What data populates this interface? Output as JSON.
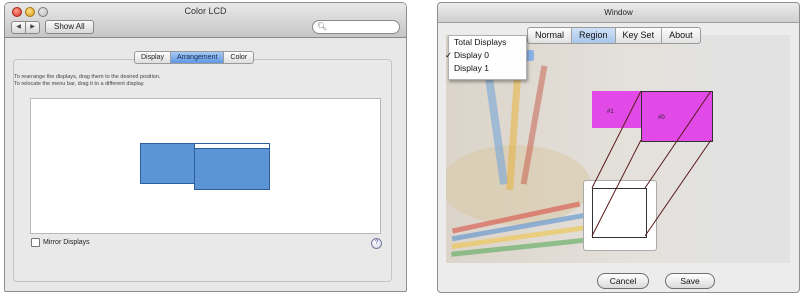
{
  "left_window": {
    "title": "Color LCD",
    "nav_back": "◀",
    "nav_forward": "▶",
    "show_all": "Show All",
    "search_icon": "search-icon",
    "search_placeholder": "",
    "tabs": [
      {
        "label": "Display",
        "active": false
      },
      {
        "label": "Arrangement",
        "active": true
      },
      {
        "label": "Color",
        "active": false
      }
    ],
    "instructions": [
      "To rearrange the displays, drag them to the desired position.",
      "To relocate the menu bar, drag it to a different display."
    ],
    "mirror_label": "Mirror Displays",
    "mirror_checked": false,
    "help_label": "?",
    "display_color": "#5b95d6"
  },
  "right_window": {
    "title": "Window",
    "tabs": [
      {
        "label": "Normal",
        "active": false
      },
      {
        "label": "Region",
        "active": true
      },
      {
        "label": "Key Set",
        "active": false
      },
      {
        "label": "About",
        "active": false
      }
    ],
    "dropdown_options": [
      {
        "label": "Total Displays",
        "checked": false
      },
      {
        "label": "Display 0",
        "checked": true
      },
      {
        "label": "Display 1",
        "checked": false
      }
    ],
    "check_mark": "✓",
    "region_labels": {
      "r1": "#1",
      "r0": "#0"
    },
    "region_color": "#e24ae8",
    "cancel_label": "Cancel",
    "save_label": "Save"
  }
}
